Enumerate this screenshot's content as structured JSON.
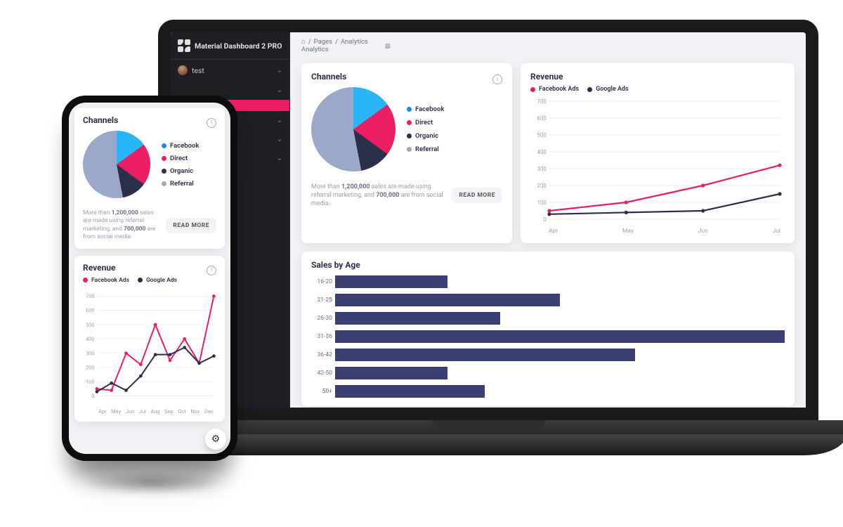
{
  "product_name": "Material Dashboard 2 PRO",
  "sidebar": {
    "user_label": "test"
  },
  "breadcrumbs": {
    "root": "Pages",
    "page": "Analytics",
    "title": "Analytics"
  },
  "channels": {
    "title": "Channels",
    "note_prefix": "More than ",
    "note_sales": "1,200,000",
    "note_mid": " sales are made using referral marketing, and ",
    "note_social": "700,000",
    "note_suffix": " are from social media.",
    "read_more": "READ MORE",
    "legend": [
      {
        "label": "Facebook",
        "color": "#1e88e5"
      },
      {
        "label": "Direct",
        "color": "#e91e63"
      },
      {
        "label": "Organic",
        "color": "#2c2f4a"
      },
      {
        "label": "Referral",
        "color": "#9aa9c9"
      }
    ]
  },
  "revenue": {
    "title": "Revenue",
    "legend": [
      {
        "label": "Facebook Ads",
        "color": "#e91e63"
      },
      {
        "label": "Google Ads",
        "color": "#2c2f4a"
      }
    ]
  },
  "sales_age": {
    "title": "Sales by Age"
  },
  "chart_data": [
    {
      "id": "channels",
      "type": "pie",
      "title": "Channels",
      "series": [
        {
          "name": "Facebook",
          "value": 15,
          "color": "#29b6f6"
        },
        {
          "name": "Direct",
          "value": 20,
          "color": "#e91e63"
        },
        {
          "name": "Organic",
          "value": 12,
          "color": "#2c2f4a"
        },
        {
          "name": "Referral",
          "value": 53,
          "color": "#9aa9c9"
        }
      ]
    },
    {
      "id": "revenue_full",
      "type": "line",
      "title": "Revenue",
      "x": [
        "Apr",
        "May",
        "Jun",
        "Jul",
        "Aug",
        "Sep",
        "Oct",
        "Nov",
        "Dec"
      ],
      "ylim": [
        0,
        700
      ],
      "yticks": [
        0,
        100,
        200,
        300,
        400,
        500,
        600,
        700
      ],
      "series": [
        {
          "name": "Facebook Ads",
          "color": "#e91e63",
          "values": [
            50,
            40,
            300,
            220,
            500,
            250,
            400,
            230,
            700
          ]
        },
        {
          "name": "Google Ads",
          "color": "#2c2f4a",
          "values": [
            30,
            90,
            40,
            140,
            290,
            290,
            340,
            230,
            280
          ]
        }
      ]
    },
    {
      "id": "revenue_laptop_visible",
      "type": "line",
      "title": "Revenue",
      "x": [
        "Apr",
        "May",
        "Jun",
        "Jul"
      ],
      "ylim": [
        0,
        700
      ],
      "yticks": [
        0,
        100,
        200,
        300,
        400,
        500,
        600,
        700
      ],
      "series": [
        {
          "name": "Facebook Ads",
          "color": "#e91e63",
          "values": [
            50,
            100,
            200,
            320
          ]
        },
        {
          "name": "Google Ads",
          "color": "#2c2f4a",
          "values": [
            30,
            40,
            50,
            150
          ]
        }
      ]
    },
    {
      "id": "sales_by_age",
      "type": "bar",
      "orientation": "horizontal",
      "title": "Sales by Age",
      "categories": [
        "16-20",
        "21-25",
        "26-30",
        "31-36",
        "36-42",
        "42-50",
        "50+"
      ],
      "values": [
        15,
        30,
        22,
        60,
        40,
        15,
        20
      ],
      "color": "#3a3f72"
    }
  ]
}
